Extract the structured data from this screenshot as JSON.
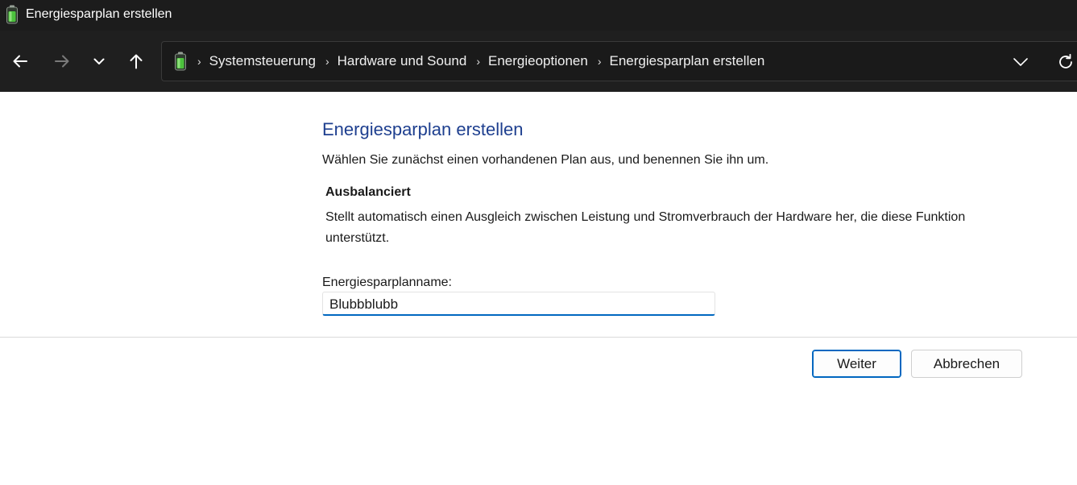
{
  "window": {
    "title": "Energiesparplan erstellen",
    "icon": "battery-icon"
  },
  "nav": {
    "back_icon": "arrow-left-icon",
    "forward_icon": "arrow-right-icon",
    "recent_icon": "chevron-down-icon",
    "up_icon": "arrow-up-icon"
  },
  "address": {
    "icon": "battery-icon",
    "breadcrumbs": [
      {
        "label": "Systemsteuerung"
      },
      {
        "label": "Hardware und Sound"
      },
      {
        "label": "Energieoptionen"
      },
      {
        "label": "Energiesparplan erstellen"
      }
    ],
    "dropdown_icon": "chevron-down-icon",
    "refresh_icon": "refresh-icon"
  },
  "main": {
    "title": "Energiesparplan erstellen",
    "instruction": "Wählen Sie zunächst einen vorhandenen Plan aus, und benennen Sie ihn um.",
    "plan": {
      "name": "Ausbalanciert",
      "description": "Stellt automatisch einen Ausgleich zwischen Leistung und Stromverbrauch der Hardware her, die diese Funktion unterstützt."
    },
    "field_label": "Energiesparplanname:",
    "field_value": "Blubbblubb"
  },
  "buttons": {
    "next_label": "Weiter",
    "cancel_label": "Abbrechen"
  },
  "colors": {
    "accent": "#0067c0",
    "title_blue": "#1e3f8f",
    "chrome_dark": "#1c1c1c"
  }
}
